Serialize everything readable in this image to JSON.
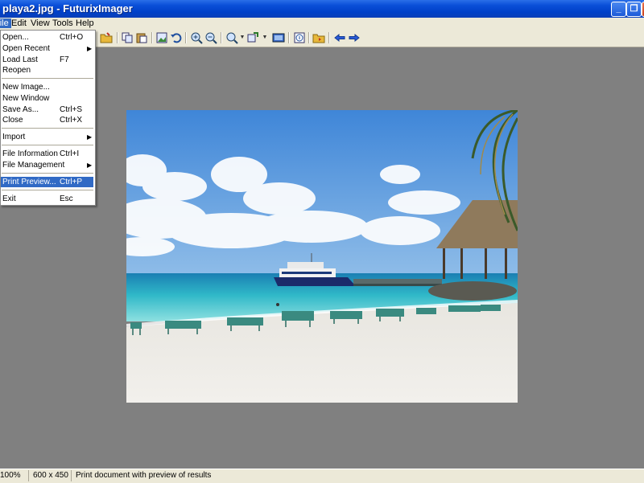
{
  "window": {
    "title": "playa2.jpg - FuturixImager"
  },
  "title_buttons": {
    "minimize": "_",
    "maximize": "❐",
    "close": "X"
  },
  "menubar": {
    "items": [
      {
        "label": "File"
      },
      {
        "label": "Edit"
      },
      {
        "label": "View"
      },
      {
        "label": "Tools"
      },
      {
        "label": "Help"
      }
    ]
  },
  "file_menu": {
    "items": [
      {
        "label": "Open...",
        "shortcut": "Ctrl+O"
      },
      {
        "label": "Open Recent",
        "shortcut": "",
        "submenu": "▶"
      },
      {
        "label": "Load Last",
        "shortcut": "F7"
      },
      {
        "label": "Reopen",
        "shortcut": ""
      },
      {
        "label": "New Image...",
        "shortcut": ""
      },
      {
        "label": "New Window",
        "shortcut": ""
      },
      {
        "label": "Save As...",
        "shortcut": "Ctrl+S"
      },
      {
        "label": "Close",
        "shortcut": "Ctrl+X"
      },
      {
        "label": "Import",
        "shortcut": "",
        "submenu": "▶"
      },
      {
        "label": "File Information",
        "shortcut": "Ctrl+I"
      },
      {
        "label": "File Management",
        "shortcut": "",
        "submenu": "▶"
      },
      {
        "label": "Print Preview...",
        "shortcut": "Ctrl+P"
      },
      {
        "label": "Exit",
        "shortcut": "Esc"
      }
    ]
  },
  "toolbar": {
    "icons": [
      "open-folder-icon",
      "copy-icon",
      "paste-icon",
      "image-icon",
      "undo-icon",
      "zoom-in-icon",
      "zoom-out-icon",
      "zoom-icon",
      "resize-icon",
      "fullscreen-icon",
      "info-icon",
      "folder-icon",
      "back-icon",
      "forward-icon"
    ]
  },
  "statusbar": {
    "zoom": "100%",
    "dimensions": "600 x 450",
    "message": "Print document with preview of results"
  },
  "colors": {
    "titlebar": "#0a4fd8",
    "menu_highlight": "#316ac5",
    "workspace": "#808080"
  }
}
